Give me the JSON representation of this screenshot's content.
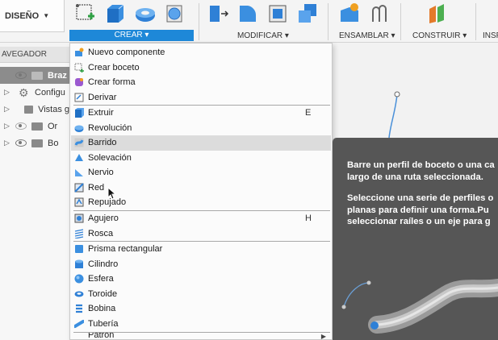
{
  "toolbar": {
    "workspace": "DISEÑO",
    "groups": [
      {
        "label": "CREAR",
        "active": true
      },
      {
        "label": "MODIFICAR",
        "active": false
      },
      {
        "label": "ENSAMBLAR",
        "active": false
      },
      {
        "label": "CONSTRUIR",
        "active": false
      },
      {
        "label": "INSP",
        "active": false
      }
    ],
    "accent_color": "#1e88d8"
  },
  "navigator": {
    "title": "AVEGADOR",
    "rows": [
      {
        "label": "Braz",
        "type": "component",
        "selected": true
      },
      {
        "label": "Configu",
        "type": "settings"
      },
      {
        "label": "Vistas g",
        "type": "folder"
      },
      {
        "label": "Or",
        "type": "folder-hidden"
      },
      {
        "label": "Bo",
        "type": "folder"
      }
    ]
  },
  "menu": {
    "items": [
      {
        "label": "Nuevo componente",
        "icon": "new-component-icon",
        "shortcut": ""
      },
      {
        "label": "Crear boceto",
        "icon": "create-sketch-icon",
        "shortcut": ""
      },
      {
        "label": "Crear forma",
        "icon": "create-form-icon",
        "shortcut": ""
      },
      {
        "label": "Derivar",
        "icon": "derive-icon",
        "shortcut": ""
      },
      {
        "label": "Extruir",
        "icon": "extrude-icon",
        "shortcut": "E"
      },
      {
        "label": "Revolución",
        "icon": "revolve-icon",
        "shortcut": ""
      },
      {
        "label": "Barrido",
        "icon": "sweep-icon",
        "shortcut": "",
        "hover": true
      },
      {
        "label": "Solevación",
        "icon": "loft-icon",
        "shortcut": ""
      },
      {
        "label": "Nervio",
        "icon": "rib-icon",
        "shortcut": ""
      },
      {
        "label": "Red",
        "icon": "web-icon",
        "shortcut": ""
      },
      {
        "label": "Repujado",
        "icon": "emboss-icon",
        "shortcut": ""
      },
      {
        "label": "Agujero",
        "icon": "hole-icon",
        "shortcut": "H"
      },
      {
        "label": "Rosca",
        "icon": "thread-icon",
        "shortcut": ""
      },
      {
        "label": "Prisma rectangular",
        "icon": "box-icon",
        "shortcut": ""
      },
      {
        "label": "Cilindro",
        "icon": "cylinder-icon",
        "shortcut": ""
      },
      {
        "label": "Esfera",
        "icon": "sphere-icon",
        "shortcut": ""
      },
      {
        "label": "Toroide",
        "icon": "torus-icon",
        "shortcut": ""
      },
      {
        "label": "Bobina",
        "icon": "coil-icon",
        "shortcut": ""
      },
      {
        "label": "Tubería",
        "icon": "pipe-icon",
        "shortcut": ""
      },
      {
        "label": "Patrón",
        "icon": "pattern-icon",
        "shortcut": ""
      }
    ]
  },
  "tooltip": {
    "line1": "Barre un perfil de boceto o una ca",
    "line2": "largo de una ruta seleccionada.",
    "line3": "Seleccione una serie de perfiles o",
    "line4": "planas para definir una forma.Pu",
    "line5": "seleccionar raíles o un eje para g"
  }
}
